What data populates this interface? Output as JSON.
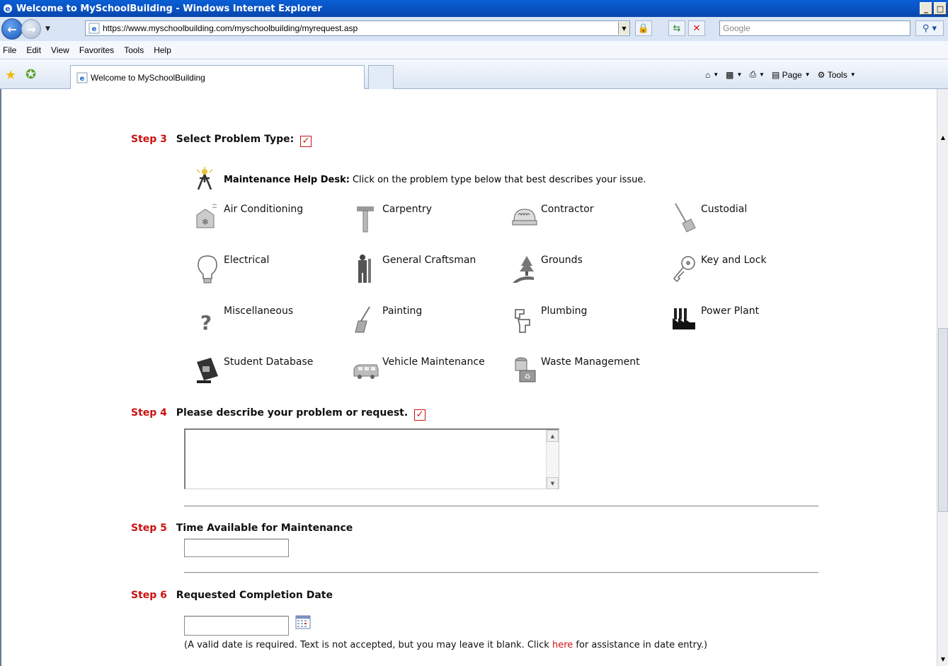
{
  "window": {
    "title": "Welcome to MySchoolBuilding - Windows Internet Explorer"
  },
  "address": {
    "url": "https://www.myschoolbuilding.com/myschoolbuilding/myrequest.asp"
  },
  "search": {
    "placeholder": "Google"
  },
  "menu": [
    "File",
    "Edit",
    "View",
    "Favorites",
    "Tools",
    "Help"
  ],
  "tab": {
    "title": "Welcome to MySchoolBuilding"
  },
  "commandbar": {
    "page": "Page",
    "tools": "Tools"
  },
  "step3": {
    "number": "Step 3",
    "label": "Select Problem Type:"
  },
  "helpdesk": {
    "title": "Maintenance Help Desk:",
    "text": "Click on the problem type below that best describes your issue."
  },
  "problem_types": [
    {
      "label": "Air Conditioning",
      "icon": "air-conditioning-icon"
    },
    {
      "label": "Carpentry",
      "icon": "hammer-icon"
    },
    {
      "label": "Contractor",
      "icon": "contractor-hat-icon"
    },
    {
      "label": "Custodial",
      "icon": "broom-icon"
    },
    {
      "label": "Electrical",
      "icon": "light-bulb-icon"
    },
    {
      "label": "General Craftsman",
      "icon": "craftsman-icon"
    },
    {
      "label": "Grounds",
      "icon": "tree-road-icon"
    },
    {
      "label": "Key and Lock",
      "icon": "key-icon"
    },
    {
      "label": "Miscellaneous",
      "icon": "question-mark-icon"
    },
    {
      "label": "Painting",
      "icon": "paintbrush-icon"
    },
    {
      "label": "Plumbing",
      "icon": "faucet-icon"
    },
    {
      "label": "Power Plant",
      "icon": "factory-icon"
    },
    {
      "label": "Student Database",
      "icon": "student-database-icon"
    },
    {
      "label": "Vehicle Maintenance",
      "icon": "van-icon"
    },
    {
      "label": "Waste Management",
      "icon": "waste-bin-icon"
    }
  ],
  "step4": {
    "number": "Step 4",
    "label": "Please describe your problem or request.",
    "value": ""
  },
  "step5": {
    "number": "Step 5",
    "label": "Time Available for Maintenance",
    "value": ""
  },
  "step6": {
    "number": "Step 6",
    "label": "Requested Completion Date",
    "value": ""
  },
  "date_note": {
    "before": "(A valid date is required. Text is not accepted, but you may leave it blank. Click ",
    "link": "here",
    "after": " for assistance in date entry.)"
  },
  "colors": {
    "step_red": "#cc1111",
    "titlebar_blue": "#0a5fd6"
  }
}
